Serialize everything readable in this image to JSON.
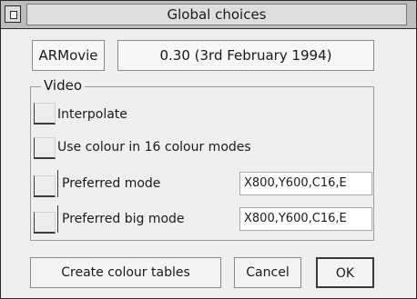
{
  "window": {
    "title": "Global choices"
  },
  "info": {
    "label": "ARMovie",
    "version": "0.30 (3rd February 1994)"
  },
  "video": {
    "legend": "Video",
    "options": {
      "interpolate": "Interpolate",
      "use_colour": "Use colour in 16 colour modes"
    },
    "preferred_mode": {
      "label": "Preferred mode",
      "value": "X800,Y600,C16,E"
    },
    "preferred_big_mode": {
      "label": "Preferred big mode",
      "value": "X800,Y600,C16,E"
    }
  },
  "buttons": {
    "create": "Create colour tables",
    "cancel": "Cancel",
    "ok": "OK"
  }
}
